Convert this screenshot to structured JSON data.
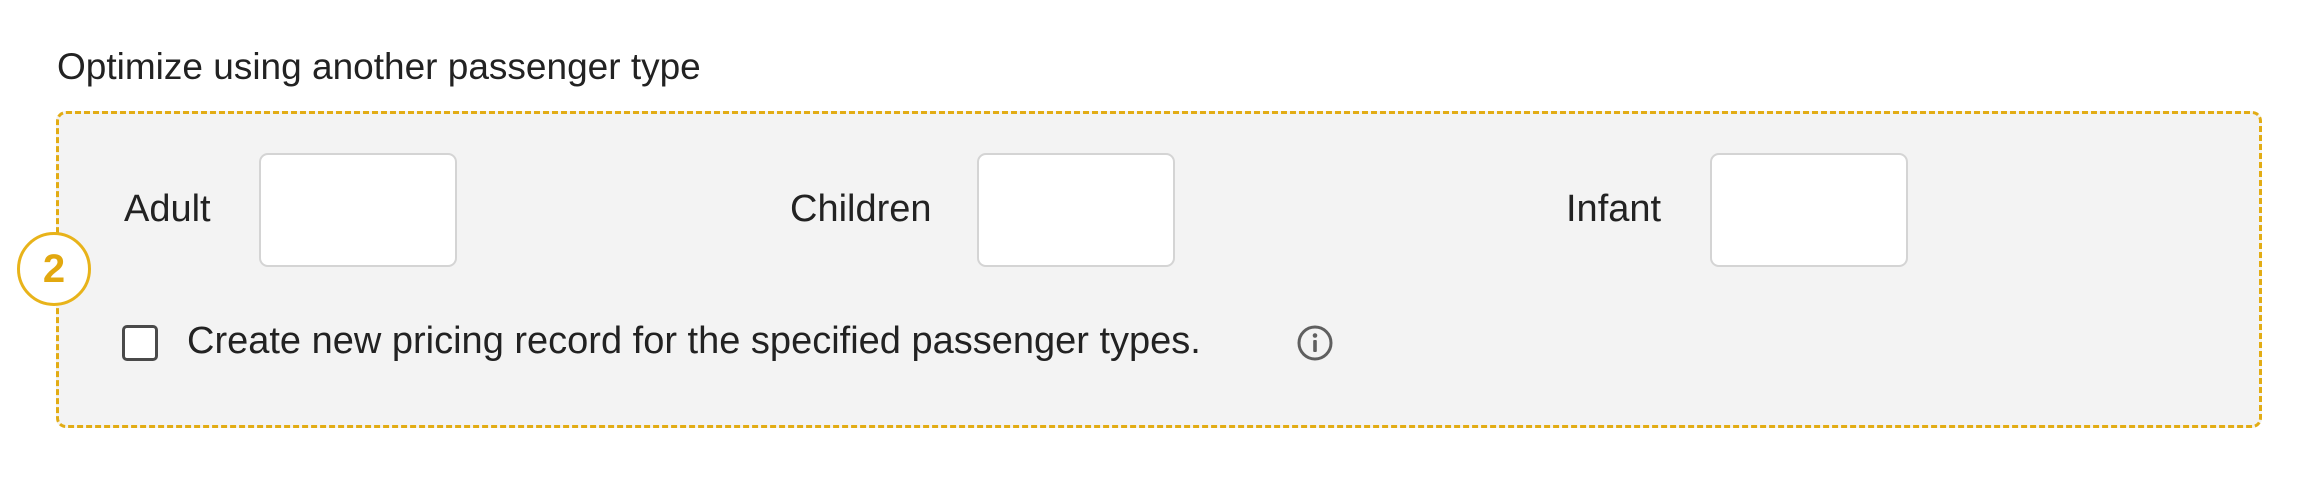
{
  "section": {
    "title": "Optimize using another passenger type",
    "step_number": "2"
  },
  "passenger_fields": {
    "adult": {
      "label": "Adult",
      "value": ""
    },
    "children": {
      "label": "Children",
      "value": ""
    },
    "infant": {
      "label": "Infant",
      "value": ""
    }
  },
  "pricing_record": {
    "checkbox_label": "Create new pricing record for the specified passenger types.",
    "checked": false,
    "info_icon": "info-circle-icon"
  },
  "colors": {
    "accent": "#e2ac14",
    "panel_background": "#f3f3f3",
    "text": "#222222"
  }
}
